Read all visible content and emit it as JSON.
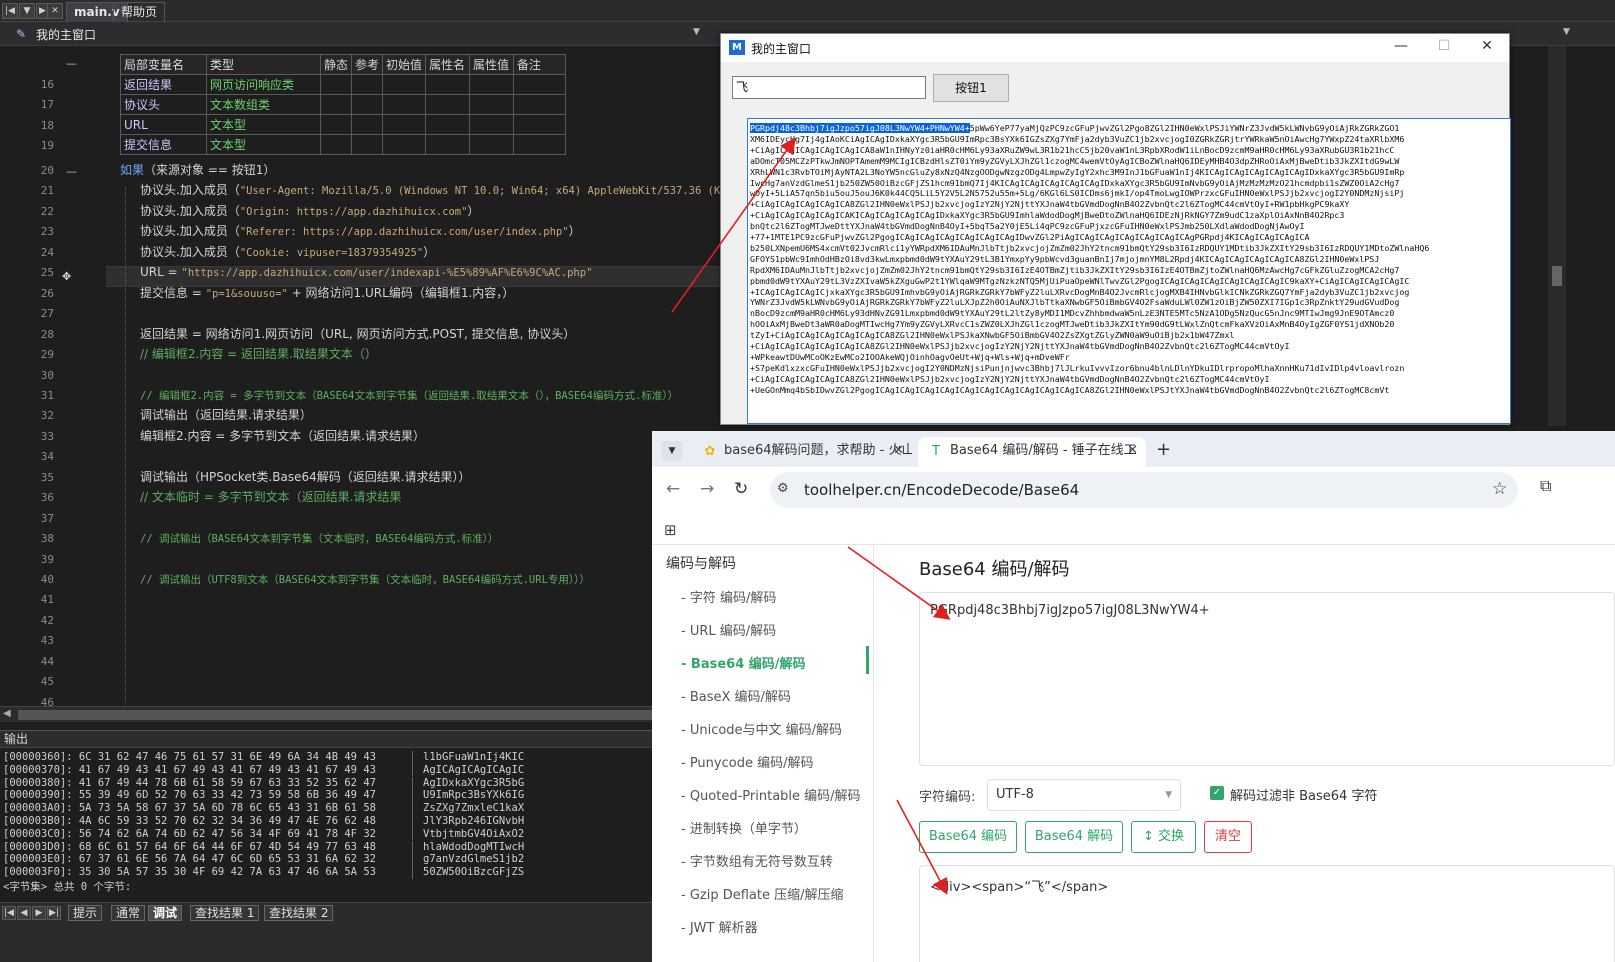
{
  "ide": {
    "tabs": [
      "main.v",
      "帮助页"
    ],
    "window_title": "我的主窗口",
    "var_table": {
      "headers": [
        "局部变量名",
        "类型",
        "静态",
        "参考",
        "初始值",
        "属性名",
        "属性值",
        "备注"
      ],
      "rows": [
        {
          "line": "16",
          "name": "返回结果",
          "type": "网页访问响应类"
        },
        {
          "line": "17",
          "name": "协议头",
          "type": "文本数组类"
        },
        {
          "line": "18",
          "name": "URL",
          "type": "文本型"
        },
        {
          "line": "19",
          "name": "提交信息",
          "type": "文本型"
        }
      ]
    },
    "code_lines": [
      {
        "n": "20",
        "parts": [
          [
            "kw",
            "如果"
          ],
          [
            "",
            "（来源对象 == 按钮1）"
          ]
        ]
      },
      {
        "n": "21",
        "parts": [
          [
            "",
            "协议头.加入成员（"
          ],
          [
            "str",
            "\"User-Agent: Mozilla/5.0 (Windows NT 10.0; Win64; x64) AppleWebKit/537.36 (KHTML,"
          ]
        ]
      },
      {
        "n": "22",
        "parts": [
          [
            "",
            "协议头.加入成员（"
          ],
          [
            "str",
            "\"Origin: https://app.dazhihuicx.com\""
          ],
          [
            "",
            "）"
          ]
        ]
      },
      {
        "n": "23",
        "parts": [
          [
            "",
            "协议头.加入成员（"
          ],
          [
            "str",
            "\"Referer: https://app.dazhihuicx.com/user/index.php\""
          ],
          [
            "",
            "）"
          ]
        ]
      },
      {
        "n": "24",
        "parts": [
          [
            "",
            "协议头.加入成员（"
          ],
          [
            "str",
            "\"Cookie: vipuser=18379354925\""
          ],
          [
            "",
            "）"
          ]
        ]
      },
      {
        "n": "25",
        "parts": [
          [
            "",
            "URL = "
          ],
          [
            "str",
            "\"https://app.dazhihuicx.com/user/indexapi-%E5%89%AF%E6%9C%AC.php\""
          ]
        ]
      },
      {
        "n": "26",
        "parts": [
          [
            "",
            "提交信息 = "
          ],
          [
            "str",
            "\"p=1&souuso=\""
          ],
          [
            "",
            " + 网络访问1.URL编码（编辑框1.内容，）"
          ]
        ]
      },
      {
        "n": "27",
        "parts": []
      },
      {
        "n": "28",
        "parts": [
          [
            "",
            "返回结果 = 网络访问1.网页访问（URL, 网页访问方式.POST, 提交信息, 协议头）"
          ]
        ]
      },
      {
        "n": "29",
        "parts": [
          [
            "cm",
            "// 编辑框2.内容 = 返回结果.取结果文本（）"
          ]
        ]
      },
      {
        "n": "30",
        "parts": []
      },
      {
        "n": "31",
        "parts": [
          [
            "cm",
            "// 编辑框2.内容 = 多字节到文本（BASE64文本到字节集（返回结果.取结果文本（），BASE64编码方式.标准））"
          ]
        ]
      },
      {
        "n": "32",
        "parts": [
          [
            "",
            "调试输出（返回结果.请求结果）"
          ]
        ]
      },
      {
        "n": "33",
        "parts": [
          [
            "",
            "编辑框2.内容 = 多字节到文本（返回结果.请求结果）"
          ]
        ]
      },
      {
        "n": "34",
        "parts": []
      },
      {
        "n": "35",
        "parts": [
          [
            "",
            "调试输出（HPSocket类.Base64解码（返回结果.请求结果））"
          ]
        ]
      },
      {
        "n": "36",
        "parts": [
          [
            "cm",
            "// 文本临时 = 多字节到文本（返回结果.请求结果"
          ]
        ]
      },
      {
        "n": "37",
        "parts": []
      },
      {
        "n": "38",
        "parts": [
          [
            "cm",
            "// 调试输出（BASE64文本到字节集（文本临时，BASE64编码方式.标准））"
          ]
        ]
      },
      {
        "n": "39",
        "parts": []
      },
      {
        "n": "40",
        "parts": [
          [
            "cm",
            "// 调试输出（UTF8到文本（BASE64文本到字节集（文本临时，BASE64编码方式.URL专用）））"
          ]
        ]
      },
      {
        "n": "41",
        "parts": []
      },
      {
        "n": "42",
        "parts": []
      },
      {
        "n": "43",
        "parts": []
      },
      {
        "n": "44",
        "parts": []
      },
      {
        "n": "45",
        "parts": []
      },
      {
        "n": "46",
        "parts": []
      }
    ],
    "output_title": "输出",
    "hex_lines": [
      [
        "[00000360]: 6C 31 62 47 46 75 61 57 31 6E 49 6A 34 4B 49 43",
        "l1bGFuaW1nIj4KIC"
      ],
      [
        "[00000370]: 41 67 49 43 41 67 49 43 41 67 49 43 41 67 49 43",
        "AgICAgICAgICAgIC"
      ],
      [
        "[00000380]: 41 67 49 44 78 6B 61 58 59 67 63 33 52 35 62 47",
        "AgIDxkaXYgc3R5bG"
      ],
      [
        "[00000390]: 55 39 49 6D 52 70 63 33 42 73 59 58 6B 36 49 47",
        "U9ImRpc3BsYXk6IG"
      ],
      [
        "[000003A0]: 5A 73 5A 58 67 37 5A 6D 78 6C 65 43 31 6B 61 58",
        "ZsZXg7ZmxleC1kaX"
      ],
      [
        "[000003B0]: 4A 6C 59 33 52 70 62 32 34 36 49 47 4E 76 62 48",
        "JlY3Rpb246IGNvbH"
      ],
      [
        "[000003C0]: 56 74 62 6A 74 6D 62 47 56 34 4F 69 41 78 4F 32",
        "VtbjtmbGV4OiAxO2"
      ],
      [
        "[000003D0]: 68 6C 61 57 64 6F 64 44 6F 67 4D 54 49 77 63 48",
        "hlaWdodDogMTIwcH"
      ],
      [
        "[000003E0]: 67 37 61 6E 56 7A 64 47 6C 6D 65 53 31 6A 62 32",
        "g7anVzdGlmeS1jb2"
      ],
      [
        "[000003F0]: 35 30 5A 57 35 30 4F 69 42 7A 63 47 46 6A 5A 53",
        "50ZW50OiBzcGFjZS"
      ]
    ],
    "output_footer": "<字节集> 总共 0 个字节:",
    "bottom_tabs": [
      "提示",
      "通常",
      "调试",
      "查找结果 1",
      "查找结果 2"
    ]
  },
  "dialog": {
    "title": "我的主窗口",
    "input_value": "飞",
    "button_label": "按钮1",
    "selected_text": "PGRpdj48c3Bhbj7igJzpo57igJ08L3NwYW4+PHNwYW4+",
    "memo_lines": [
      "5pWw6YeP77yaMjQzPC9zcGFuPjwvZGl2Pgo8ZGl2IHN0eWxlPSJiYWNrZ3JvdW5kLWNvbG9yOiAjRkZGRkZGO1",
      "XM6IDEycHg7Ij4gIAoKCiAgICAgIDxkaXYgc3R5bGU9ImRpc3BsYXk6IGZsZXg7YmFja2dyb3VuZC1jb2xvcjogI0ZGRkZGRjtrYWRkaW5nOiAwcHg7YWxpZ24taXRlbXM6",
      "+CiAgICAgICAgICAgICAgICA8aW1nIHNyYz0iaHR0cHM6Ly93aXRuZW9wL3R1b21hcC5jb20vaW1nL3RpbXRodW1iLnBocD9zcmM9aHR0cHM6Ly93aXRubGU3R1b21hcC",
      "aDOmcT05MCZzPTkwJmNOPTAmemM9MCIgICBzdHlsZT0iYm9yZGVyLXJhZGl1czogMC4wemVtOyAgICBoZWlnaHQ6IDEyMHB4O3dpZHRoOiAxMjBweDtib3JkZXItdG9wLW",
      "XRhLWN1c3RvbTOiMjAyNTA2L3NoYW5ncGluZy8xNzQ4NzgOODgwNzgzODg4LmpwZyIgY2xhc3M9InJ1bGFuaW1nIj4KICAgICAgICAgICAgICAgIDxkaXYgc3R5bGU9ImRp",
      "IwcHg7anVzdGlmeS1jb250ZW50OiBzcGFjZS1hcm91bmQ7Ij4KICAgICAgICAgICAgICAgIDxkaXYgc3R5bGU9ImNvbG9yOiAjMzMzMzMzO21hcmdpbi1sZWZ0OiA2cHg7",
      "wOyI+5LiA57qn5biu5ouJ5ouJ6K0k44CQ5LiL5Y2V5L2N5752u55m+5Lg/6KGl6LS0ICDms6jmkI/op4TmoLwgIOWPrzxcGFuIHN0eWxlPSJjb2xvcjogI2Y0NDMzNjsiPj",
      "+CiAgICAgICAgICAgICA8ZGl2IHN0eWxlPSJjb2xvcjogIzY2NjY2NjttYXJnaW4tbGVmdDogNnB4O2ZvbnQtc2l6ZTogMC44cmVtOyI+RW1pbHkgPC9kaXY",
      "+CiAgICAgICAgICAgICAKICAgICAgICAgICAgIDxkaXYgc3R5bGU9ImhlaWdodDogMjBweDtoZWlnaHQ6IDEzNjRkNGY7Zm9udC1zaXplOiAxNnB4O2Rpc3",
      "bnQtc2l6ZTogMTJweDttYXJnaW4tbGVmdDogNnB4OyI+5bqT5a2Y0jE5Li4qPC9zcGFuPjxzcGFuIHN0eWxlPSJmb250LXdlaWdodDogNjAwOyI",
      "+77+1MTE1PC9zcGFuPjwvZGl2PgogICAgICAgICAgICAgICAgICAgIDwvZGl2PiAgICAgICAgICAgICAgICAgICAgPGRpdj4KICAgICAgICAgICA",
      "b250LXNpemU6MS4xcmVt02JvcmRlci1yYWRpdXM6IDAuMnJlbTtjb2xvcjojZmZm02JhY2tncm91bmQtY29sb3I6IzRDQUY1MDtib3JkZXItY29sb3I6IzRDQUY1MDtoZWlnaHQ6",
      "GFOYS1pbWc9ImhOdHBzOi8vd3kwLmxpbmd0dW9tYXAuY29tL3B1YmxpYy9pbWcvd3guanBnIj7mjojmnYM8L2Rpdj4KICAgICAgICAgICAgICA8ZGl2IHN0eWxlPSJ",
      "RpdXM6IDAuMnJlbTtjb2xvcjojZmZm02JhY2tncm91bmQtY29sb3I6IzE4OTBmZjtib3JkZXItY29sb3I6IzE4OTBmZjtoZWlnaHQ6MzAwcHg7cGFkZGluZzogMCA2cHg7",
      "pbmd0dW9tYXAuY29tL3VzZXIvaW5kZXguGwP2t1YWlqaW9MTgzNzkzNTQ5MjUiPuaOpeWNlTwvZGl2PgogICAgICAgICAgICAgICAgICAgIC9kaXY+CiAgICAgICAgICAgIC",
      "+ICAgICAgICAgICjxkaXYgc3R5bGU9ImhvbG9yOiAjRGRkZGRkY7bWFyZ2luLXRvcDogMnB4O2JvcmRlcjogMXB4IHNvbGlkICNkZGRkZGQ7YmFja2dyb3VuZC1jb2xvcjog",
      "YWNrZ3JvdW5kLWNvbG9yOiAjRGRkZGRkY7bWFyZ2luLXJpZ2h0OiAuNXJlbTtkaXNwbGF5OiBmbGV4O2FsaWduLWl0ZW1zOiBjZW50ZXI7IGp1c3RpZnktY29udGVudDog",
      "nBocD9zcmM9aHR0cHM6Ly93dHNvZG91Lmxpbmd0dW9tYXAuY29tL2ltZy8yMDI1MDcvZhhbmdwaW5nLzE3NTE5MTc5NzA1ODg5NzQucG5nJnc9MTIwJmg9JnE9OTAmcz0",
      "hOOiAxMjBweDt3aWR0aDogMTIwcHg7Ym9yZGVyLXRvcC1sZWZ0LXJhZGl1czogMTJweDtib3JkZXItYm90dG9tLWxlZnQtcmFkaXVzOiAxMnB4OyIgZGF0YS1jdXNOb20",
      "tZyI+CiAgICAgICAgICAgICAgICA8ZGl2IHN0eWxlPSJkaXNwbGF5OiBmbGV4O2ZsZXgtZGlyZWN0aW9uOiBjb2x1bW47Zmxl",
      "+CiAgICAgICAgICAgICAgICA8ZGl2IHN0eWxlPSJjb2xvcjogIzY2NjY2NjttYXJnaW4tbGVmdDogNnB4O2ZvbnQtc2l6ZTogMC44cmVtOyI",
      "+WPkeawtDUwMCoOKzEwMCo2IOOAkeWQjOinhOagvOeUt+Wjq+Wls+Wjq+mDveWFr",
      "+S7peKdlxzxcGFuIHN0eWxlPSJjb2xvcjogI2Y0NDMzNjsiPunjnjwvc3Bhbj7lJLrkuIvvvIzor6bnu4blnLDlnYDkuIDlrpropoMlhaXnnHKu71dIvIDlp4vloavlrozn",
      "+CiAgICAgICAgICAgICA8ZGl2IHN0eWxlPSJjb2xvcjogIzY2NjY2NjttYXJnaW4tbGVmdDogNnB4O2ZvbnQtc2l6ZTogMC44cmVtOyI",
      "+UeGOnMmq4bSbIDwvZGl2PgogICAgICAgICAgICAgICAgICAgICAgICAgICAgICAgICA8ZGl2IHN0eWxlPSJtYXJnaW4tbGVmdDogNnB4O2ZvbnQtc2l6ZTogMC8cmVt"
    ]
  },
  "browser": {
    "tabs": [
      {
        "title": "base64解码问题，求帮助 - 火山",
        "icon": "bulb-icon"
      },
      {
        "title": "Base64 编码/解码 - 锤子在线工",
        "icon": "hammer-icon"
      }
    ],
    "url": "toolhelper.cn/EncodeDecode/Base64",
    "sidebar": {
      "heading": "编码与解码",
      "items": [
        "- 字符  编码/解码",
        "- URL  编码/解码",
        "- Base64  编码/解码",
        "- BaseX  编码/解码",
        "- Unicode与中文  编码/解码",
        "- Punycode  编码/解码",
        "- Quoted-Printable  编码/解码",
        "- 进制转换（单字节）",
        "- 字节数组有无符号数互转",
        "- Gzip Deflate 压缩/解压缩",
        "- JWT 解析器"
      ],
      "active_index": 2
    },
    "main": {
      "heading": "Base64 编码/解码",
      "input_text": "PGRpdj48c3Bhbj7igJzpo57igJ08L3NwYW4+",
      "charset_label": "字符编码:",
      "charset_value": "UTF-8",
      "filter_label": "解码过滤非 Base64 字符",
      "filter_checked": true,
      "buttons": [
        "Base64 编码",
        "Base64 解码",
        "↕ 交换",
        "清空"
      ],
      "output_text": "<div><span>“飞”</span>"
    }
  },
  "colors": {
    "accent_green": "#31a56b",
    "danger_red": "#e03a3a",
    "arrow_red": "#e02020",
    "selection_blue": "#0a64d8"
  }
}
